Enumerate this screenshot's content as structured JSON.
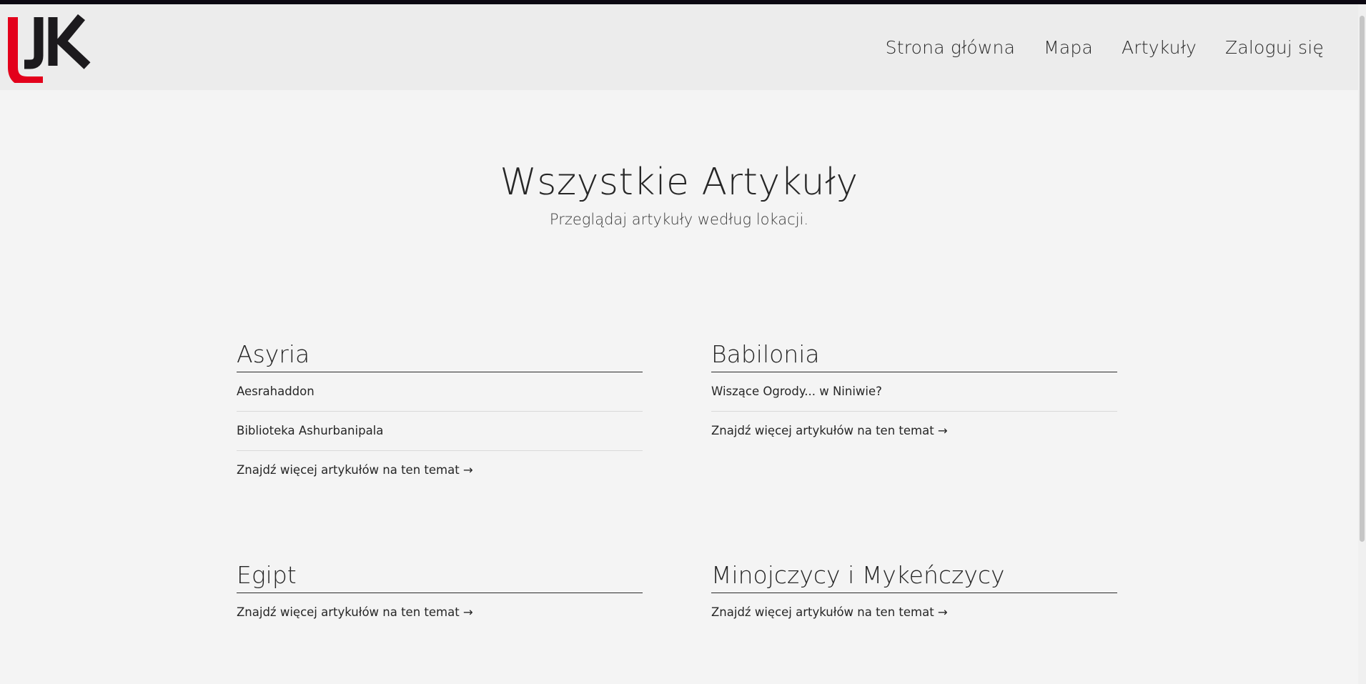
{
  "brand": {
    "logo_icon": "uk-logo-icon",
    "accent_color": "#e3001b",
    "dark_color": "#1c1a1d"
  },
  "nav": {
    "items": [
      {
        "label": "Strona główna"
      },
      {
        "label": "Mapa"
      },
      {
        "label": "Artykuły"
      },
      {
        "label": "Zaloguj się"
      }
    ]
  },
  "hero": {
    "title": "Wszystkie Artykuły",
    "subtitle": "Przeglądaj artykuły według lokacji."
  },
  "sections": [
    {
      "title": "Asyria",
      "articles": [
        "Aesrahaddon",
        "Biblioteka Ashurbanipala"
      ],
      "more_label": "Znajdź więcej artykułów na ten temat →"
    },
    {
      "title": "Babilonia",
      "articles": [
        "Wiszące Ogrody... w Niniwie?"
      ],
      "more_label": "Znajdź więcej artykułów na ten temat →"
    },
    {
      "title": "Egipt",
      "articles": [],
      "more_label": "Znajdź więcej artykułów na ten temat →"
    },
    {
      "title": "Minojczycy i Mykeńczycy",
      "articles": [],
      "more_label": "Znajdź więcej artykułów na ten temat →"
    }
  ]
}
